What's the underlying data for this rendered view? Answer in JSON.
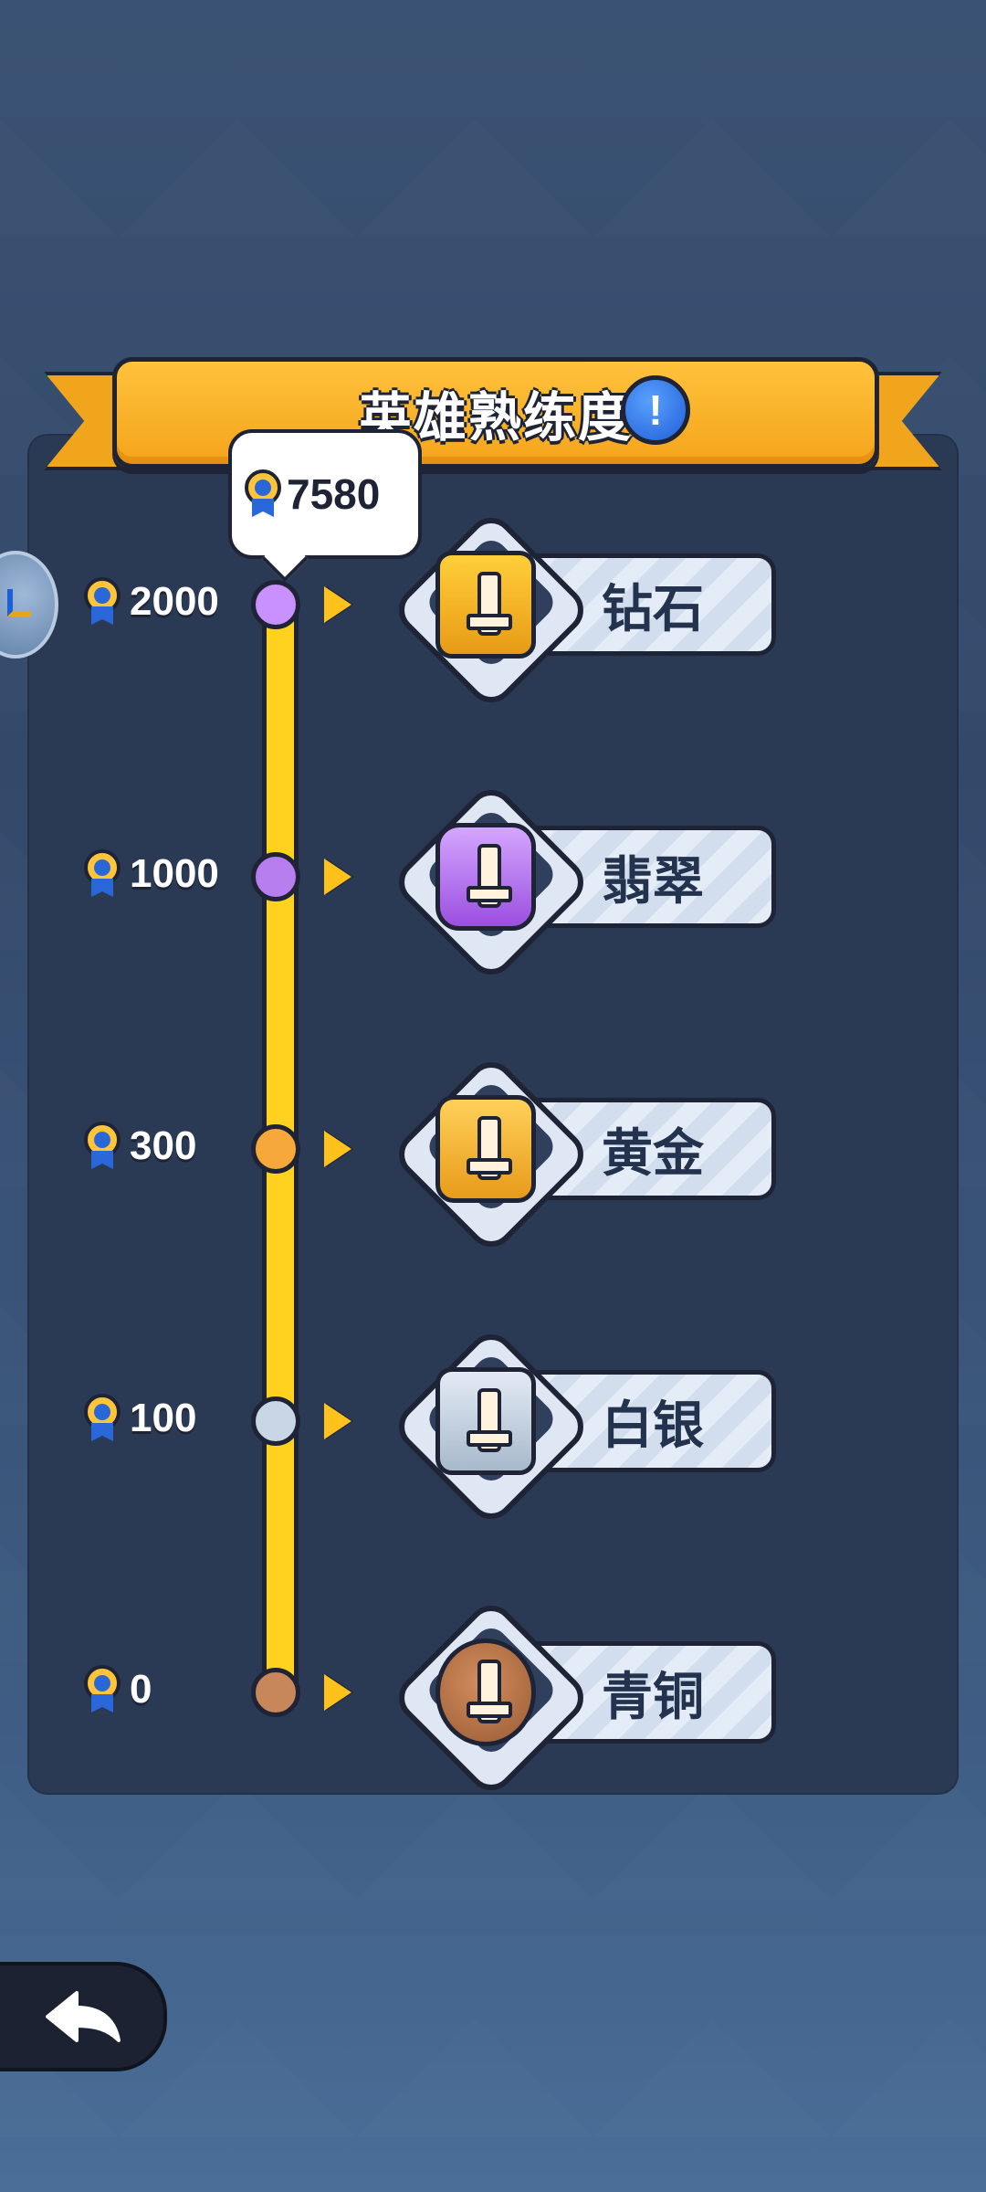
{
  "header": {
    "title": "英雄熟练度",
    "info_icon": "info-icon",
    "info_glyph": "!"
  },
  "current_score": {
    "value": "7580",
    "icon": "medal-icon"
  },
  "tiers": [
    {
      "threshold": "2000",
      "rank": "钻石",
      "emblem": "diamond-rank-emblem-icon"
    },
    {
      "threshold": "1000",
      "rank": "翡翠",
      "emblem": "emerald-rank-emblem-icon"
    },
    {
      "threshold": "300",
      "rank": "黄金",
      "emblem": "gold-rank-emblem-icon"
    },
    {
      "threshold": "100",
      "rank": "白银",
      "emblem": "silver-rank-emblem-icon"
    },
    {
      "threshold": "0",
      "rank": "青铜",
      "emblem": "bronze-rank-emblem-icon"
    }
  ],
  "progress_fraction": 1.0,
  "colors": {
    "track": "#ffd21f",
    "banner": "#f5a41c",
    "panel": "#2a3a55",
    "arrow": "#ffc11c"
  },
  "back_button_icon": "back-arrow-icon"
}
